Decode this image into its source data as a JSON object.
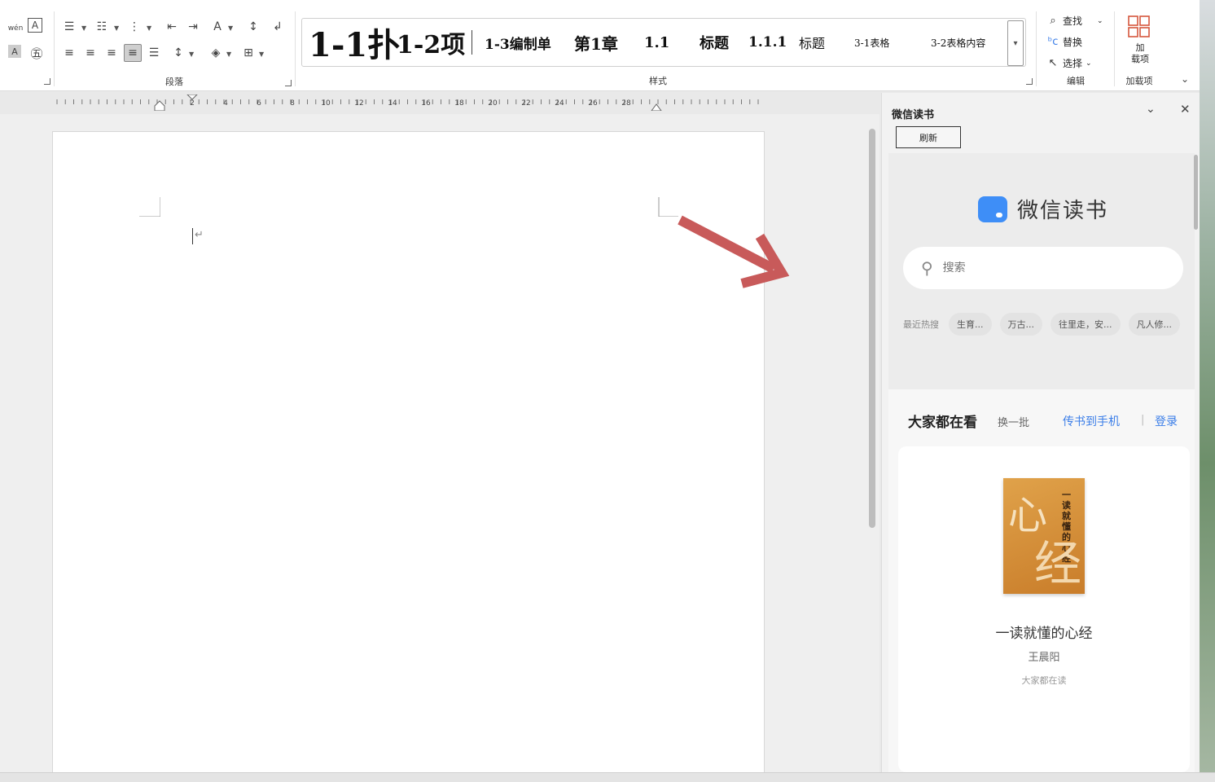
{
  "ribbon": {
    "paragraph_group_label": "段落",
    "styles_group_label": "样式",
    "edit_group_label": "编辑",
    "addins_group_label": "加载项",
    "styles": [
      {
        "label": "1-1扑"
      },
      {
        "label": "1-2项"
      },
      {
        "label": "1-3编制单"
      },
      {
        "label": "第1章"
      },
      {
        "label": "1.1"
      },
      {
        "label": "标题"
      },
      {
        "label": "1.1.1"
      },
      {
        "label": "标题"
      },
      {
        "label": "3-1表格"
      },
      {
        "label": "3-2表格内容"
      }
    ],
    "edit": {
      "find_label": "查找",
      "replace_label": "替换",
      "select_label": "选择"
    },
    "addins_button_label": "加\n载项"
  },
  "ruler": {
    "labels": [
      "2",
      "4",
      "6",
      "8",
      "10",
      "12",
      "14",
      "16",
      "18",
      "20",
      "22",
      "24",
      "26",
      "28"
    ]
  },
  "document": {
    "paragraph_mark": "↵"
  },
  "panel": {
    "title": "微信读书",
    "refresh_label": "刷新",
    "brand_name": "微信读书",
    "search_placeholder": "搜索",
    "hot_label": "最近热搜",
    "hot_chips": [
      "生育...",
      "万古...",
      "往里走，安...",
      "凡人修..."
    ],
    "section_title": "大家都在看",
    "swap_label": "换一批",
    "send_to_phone_label": "传书到手机",
    "divider": "|",
    "login_label": "登录",
    "book": {
      "title": "一读就懂的心经",
      "author": "王晨阳",
      "note": "大家都在读",
      "cover_text_big1": "心",
      "cover_text_big2": "经",
      "cover_vertical": "一读就懂的心经"
    }
  },
  "colors": {
    "accent_blue": "#3b7ee8",
    "arrow_red": "#c85a5a",
    "brand_blue": "#3e8ef7"
  }
}
